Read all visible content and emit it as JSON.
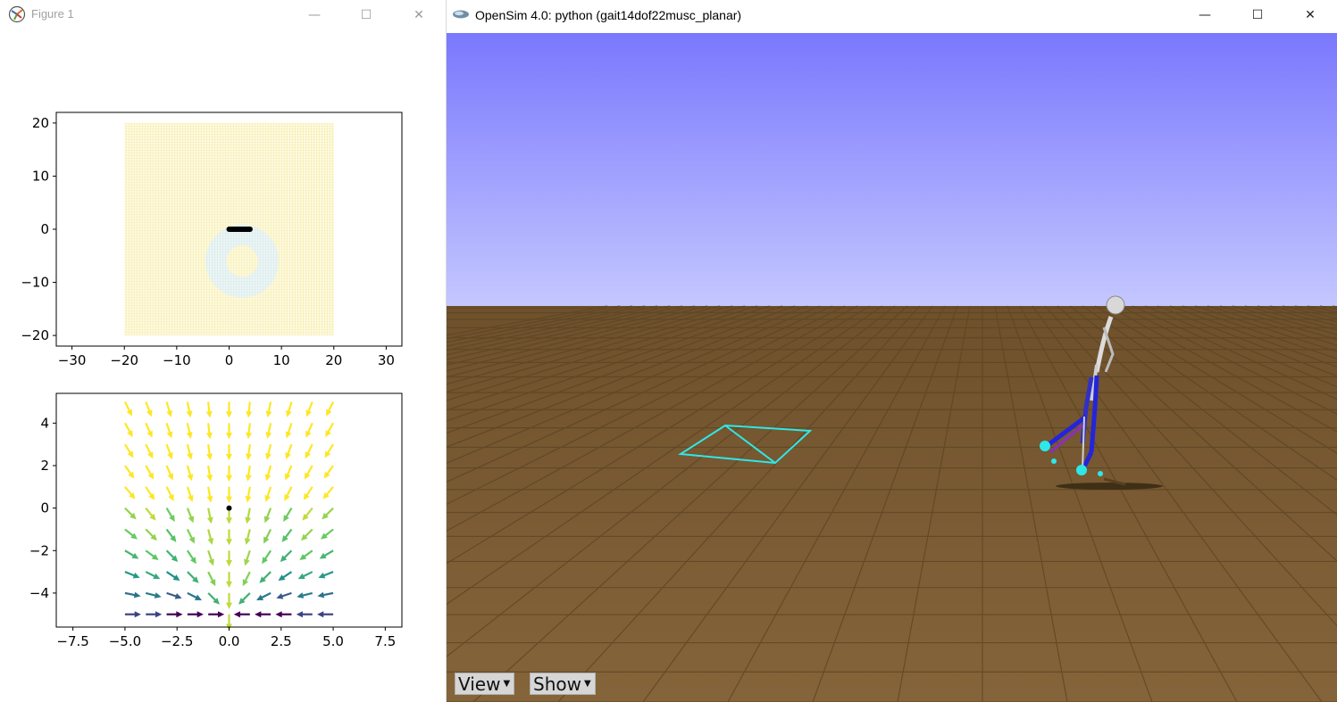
{
  "figure_window": {
    "title": "Figure 1",
    "controls": {
      "minimize": "—",
      "maximize": "☐",
      "close": "✕"
    }
  },
  "chart_data": [
    {
      "type": "heatmap",
      "title": "",
      "xlabel": "",
      "ylabel": "",
      "xlim": [
        -33,
        33
      ],
      "ylim": [
        -22,
        22
      ],
      "xticks": [
        -30,
        -20,
        -10,
        0,
        10,
        20,
        30
      ],
      "yticks": [
        -20,
        -10,
        0,
        10,
        20
      ],
      "grid_extent": {
        "x": [
          -20,
          20
        ],
        "y": [
          -20,
          20
        ]
      },
      "field_color": "#f7e97a",
      "ring": {
        "center": [
          2.5,
          -6
        ],
        "inner_radius": 3,
        "outer_radius": 7,
        "color": "#c9e3e3"
      },
      "marker": {
        "x": [
          0,
          4
        ],
        "y": [
          0,
          0
        ],
        "color": "#000000"
      }
    },
    {
      "type": "quiver",
      "title": "",
      "xlabel": "",
      "ylabel": "",
      "xlim": [
        -8.3,
        8.3
      ],
      "ylim": [
        -5.6,
        5.4
      ],
      "xticks": [
        -7.5,
        -5.0,
        -2.5,
        0.0,
        2.5,
        5.0,
        7.5
      ],
      "xtick_labels": [
        "−7.5",
        "−5.0",
        "−2.5",
        "0.0",
        "2.5",
        "5.0",
        "7.5"
      ],
      "yticks": [
        -4,
        -2,
        0,
        2,
        4
      ],
      "ytick_labels": [
        "−4",
        "−2",
        "0",
        "2",
        "4"
      ],
      "x": [
        -5,
        -4,
        -3,
        -2,
        -1,
        0,
        1,
        2,
        3,
        4,
        5
      ],
      "y": [
        5,
        4,
        3,
        2,
        1,
        0,
        -1,
        -2,
        -3,
        -4,
        -5
      ],
      "field": "unit arrows pointing toward (0,-5), colored by magnitude",
      "colormap": "viridis",
      "center_point": [
        0,
        0
      ]
    }
  ],
  "opensim_window": {
    "title": "OpenSim 4.0: python (gait14dof22musc_planar)",
    "controls": {
      "minimize": "—",
      "maximize": "☐",
      "close": "✕"
    },
    "colors": {
      "sky_top": "#7b79fd",
      "sky_bottom": "#c3c6ff",
      "ground": "#7b5b31",
      "target": "#2ee8e8",
      "muscle": "#2424dd"
    },
    "menus": [
      {
        "label": "View"
      },
      {
        "label": "Show"
      }
    ]
  }
}
